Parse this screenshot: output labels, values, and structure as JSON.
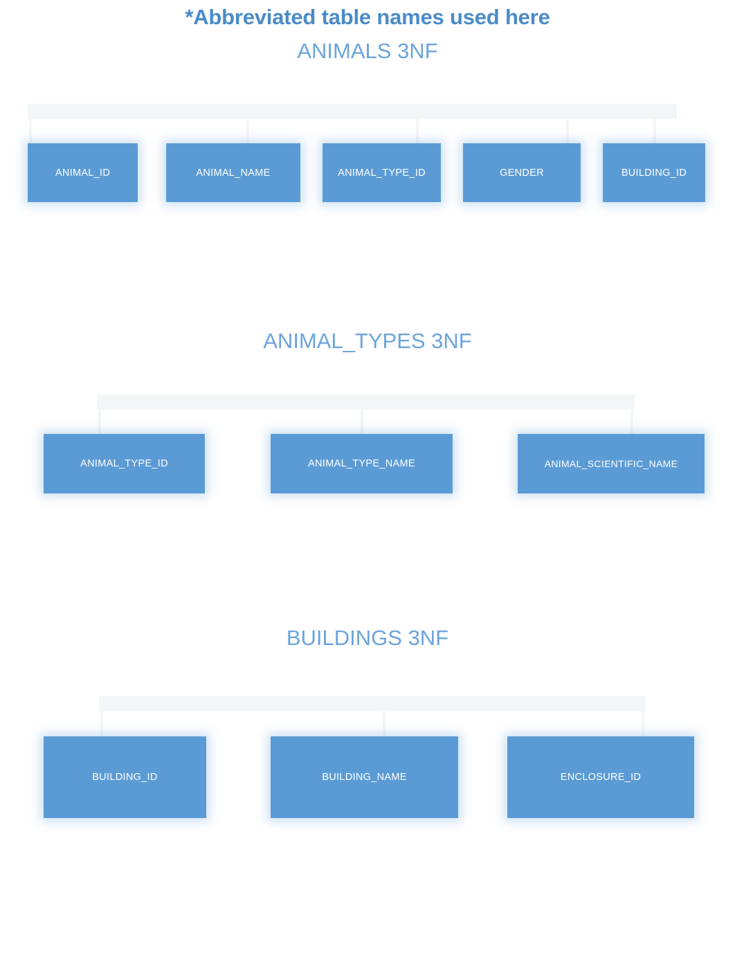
{
  "document": {
    "note": "*Abbreviated table names used here",
    "accent_color": "#5B9BD5",
    "title_color": "#6BA4DC",
    "note_color": "#4A8BC9",
    "connector_color": "#F2F6F8",
    "background_color": "#FFFFFF"
  },
  "sections": [
    {
      "id": "animals",
      "title": "ANIMALS 3NF",
      "nodes": [
        {
          "label": "ANIMAL_ID"
        },
        {
          "label": "ANIMAL_NAME"
        },
        {
          "label": "ANIMAL_TYPE_ID"
        },
        {
          "label": "GENDER"
        },
        {
          "label": "BUILDING_ID"
        }
      ]
    },
    {
      "id": "animal_types",
      "title": "ANIMAL_TYPES 3NF",
      "nodes": [
        {
          "label": "ANIMAL_TYPE_ID"
        },
        {
          "label": "ANIMAL_TYPE_NAME"
        },
        {
          "label": "ANIMAL_SCIENTIFIC_NAME"
        }
      ]
    },
    {
      "id": "buildings",
      "title": "BUILDINGS 3NF",
      "nodes": [
        {
          "label": "BUILDING_ID"
        },
        {
          "label": "BUILDING_NAME"
        },
        {
          "label": "ENCLOSURE_ID"
        }
      ]
    }
  ]
}
